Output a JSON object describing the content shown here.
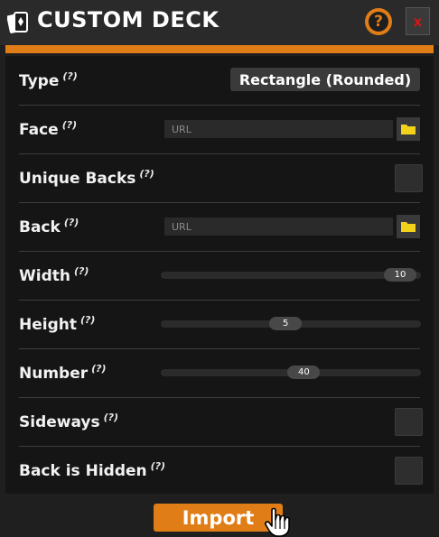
{
  "window": {
    "title": "CUSTOM DECK",
    "help_label": "?",
    "close_label": "x"
  },
  "colors": {
    "accent": "#e07d16",
    "close": "#d01818",
    "folder": "#f2d21b"
  },
  "rows": {
    "type": {
      "label": "Type",
      "hint": "(?)",
      "value": "Rectangle (Rounded)"
    },
    "face": {
      "label": "Face",
      "hint": "(?)",
      "placeholder": "URL",
      "icon": "folder-icon"
    },
    "unique_backs": {
      "label": "Unique Backs",
      "hint": "(?)",
      "checked": false
    },
    "back": {
      "label": "Back",
      "hint": "(?)",
      "placeholder": "URL",
      "icon": "folder-icon"
    },
    "width": {
      "label": "Width",
      "hint": "(?)",
      "value": "10",
      "fraction": 0.92
    },
    "height": {
      "label": "Height",
      "hint": "(?)",
      "value": "5",
      "fraction": 0.48
    },
    "number": {
      "label": "Number",
      "hint": "(?)",
      "value": "40",
      "fraction": 0.55
    },
    "sideways": {
      "label": "Sideways",
      "hint": "(?)",
      "checked": false
    },
    "back_hidden": {
      "label": "Back is Hidden",
      "hint": "(?)",
      "checked": false
    }
  },
  "import_label": "Import"
}
